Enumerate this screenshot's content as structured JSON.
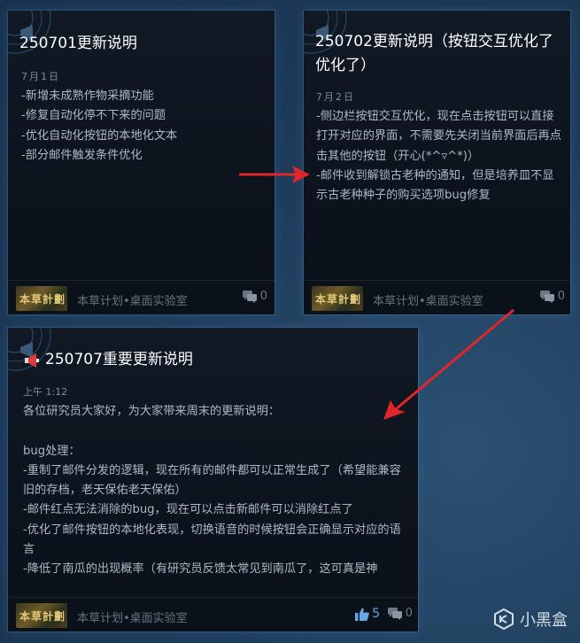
{
  "cards": [
    {
      "title": "250701更新说明",
      "date": "7月1日",
      "body": "-新增未成熟作物采摘功能\n-修复自动化停不下来的问题\n-优化自动化按钮的本地化文本\n-部分邮件触发条件优化",
      "footer_logo_text": "本草計劃",
      "footer_name": "本草计划•桌面实验室",
      "comments": "0"
    },
    {
      "title": "250702更新说明（按钮交互优化了优化了）",
      "date": "7月2日",
      "body": "-侧边栏按钮交互优化，现在点击按钮可以直接打开对应的界面，不需要先关闭当前界面后再点击其他的按钮（开心(*^▿^*)）\n-邮件收到解锁古老种的通知，但是培养皿不显示古老种种子的购买选项bug修复",
      "footer_logo_text": "本草計劃",
      "footer_name": "本草计划•桌面实验室",
      "comments": "0"
    },
    {
      "title": "250707重要更新说明",
      "date": "上午 1:12",
      "body": "各位研究员大家好，为大家带来周末的更新说明：\n\nbug处理：\n-重制了邮件分发的逻辑，现在所有的邮件都可以正常生成了（希望能兼容旧的存档，老天保佑老天保佑）\n-邮件红点无法消除的bug，现在可以点击新邮件可以消除红点了\n-优化了邮件按钮的本地化表现，切换语音的时候按钮会正确显示对应的语言\n-降低了南瓜的出现概率（有研究员反馈太常见到南瓜了，这可真是神",
      "footer_logo_text": "本草計劃",
      "footer_name": "本草计划•桌面实验室",
      "likes": "5",
      "comments": "0"
    }
  ],
  "watermark": "小黑盒",
  "colors": {
    "background": "#1f3d5c",
    "card": "#0f1620",
    "arrow": "#e0262b",
    "like": "#67a7e6"
  },
  "icons": [
    "megaphone-icon",
    "comment-icon",
    "thumbs-up-icon",
    "heybox-logo-icon"
  ]
}
